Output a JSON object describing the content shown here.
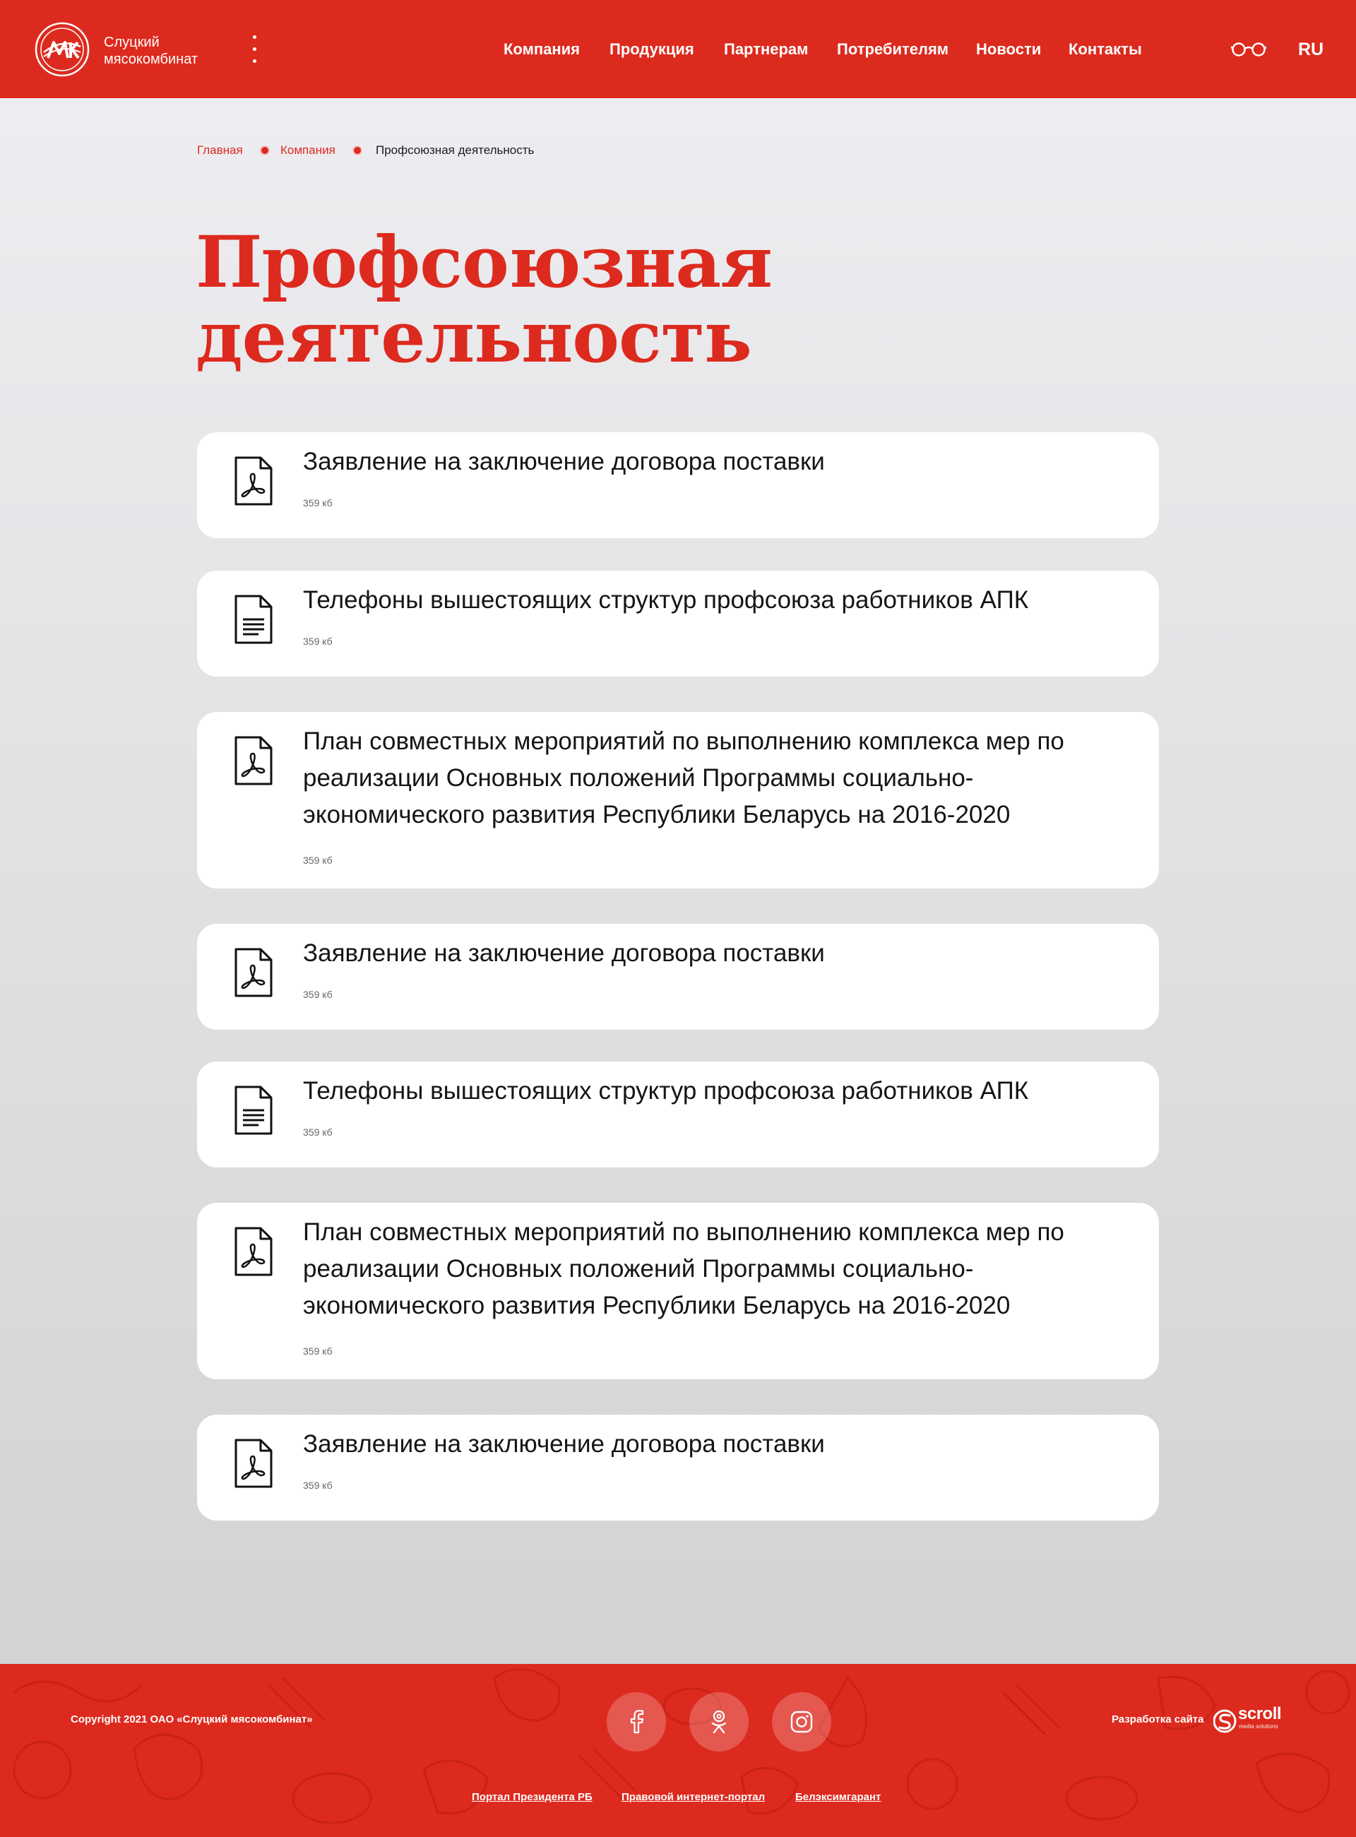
{
  "header": {
    "brand_line1": "Слуцкий",
    "brand_line2": "мясокомбинат",
    "nav": [
      "Компания",
      "Продукция",
      "Партнерам",
      "Потребителям",
      "Новости",
      "Контакты"
    ],
    "lang": "RU",
    "icons": [
      "logo-icon",
      "more-dots-icon",
      "glasses-icon"
    ],
    "accent_color": "#dd2a1e"
  },
  "breadcrumb": {
    "items": [
      "Главная",
      "Компания"
    ],
    "current": "Профсоюзная деятельность"
  },
  "page_title": {
    "line1": "Профсоюзная",
    "line2": "деятельность"
  },
  "documents": [
    {
      "title": "Заявление на заключение договора поставки",
      "size": "359 кб",
      "icon": "pdf-file-icon"
    },
    {
      "title": "Телефоны вышестоящих структур профсоюза работников АПК",
      "size": "359 кб",
      "icon": "text-file-icon"
    },
    {
      "title": "План совместных мероприятий по выполнению комплекса мер по реализации Основных положений Программы социально-экономического развития Республики Беларусь на 2016-2020",
      "size": "359 кб",
      "icon": "pdf-file-icon"
    },
    {
      "title": "Заявление на заключение договора поставки",
      "size": "359 кб",
      "icon": "pdf-file-icon"
    },
    {
      "title": "Телефоны вышестоящих структур профсоюза работников АПК",
      "size": "359 кб",
      "icon": "text-file-icon"
    },
    {
      "title": "План совместных мероприятий по выполнению комплекса мер по реализации Основных положений Программы социально-экономического развития Республики Беларусь на 2016-2020",
      "size": "359 кб",
      "icon": "pdf-file-icon"
    },
    {
      "title": "Заявление на заключение договора поставки",
      "size": "359 кб",
      "icon": "pdf-file-icon"
    }
  ],
  "footer": {
    "copyright": "Copyright 2021 ОАО «Слуцкий мясокомбинат»",
    "social": [
      "facebook-icon",
      "odnoklassniki-icon",
      "instagram-icon"
    ],
    "developer_label": "Разработка сайта",
    "developer_name": "scroll",
    "developer_tagline": "media solutions",
    "links": [
      "Портал Президента РБ",
      "Правовой интернет-портал",
      "Белэксимгарант"
    ]
  }
}
